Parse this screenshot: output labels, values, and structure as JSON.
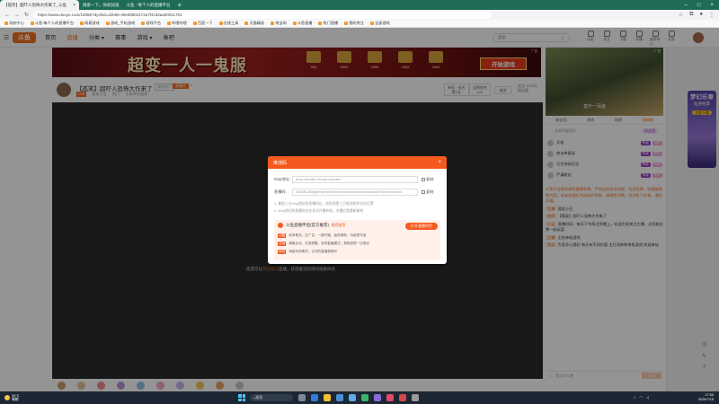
{
  "browser": {
    "tabs": [
      {
        "label": "【孤笑】超吓人恐怖大作来了_斗鱼",
        "active": true
      },
      {
        "label": "搜索一下，你就知道",
        "active": false
      },
      {
        "label": "斗鱼 - 每个人的直播平台",
        "active": false
      }
    ],
    "url": "https://www.douyu.com/10068?dyshid=d1b95-30e00804172a7f4cd2aa00011701",
    "bookmarks": [
      "导航中心",
      "斗鱼-每个人的直播平台",
      "网易游戏",
      "游戏_手机游戏",
      "游戏平台",
      "哔哩哔哩",
      "百度一下",
      "在线工具",
      "天猫精选",
      "淘宝网",
      "斗鱼直播",
      "热门直播",
      "我的关注",
      "全部游戏"
    ]
  },
  "site": {
    "logo": "斗鱼",
    "nav": [
      "首页",
      "直播",
      "分类",
      "赛事",
      "游戏",
      "鱼吧"
    ],
    "active_nav": "直播",
    "search_placeholder": "搜索",
    "header_icons": [
      "历史",
      "关注",
      "下载",
      "开播",
      "创作中心",
      "任务"
    ]
  },
  "banner": {
    "title": "超变一人一鬼服",
    "button": "开始游戏",
    "ad_label": "广告",
    "items": [
      "888",
      "6888",
      "5888",
      "2888",
      "1888"
    ]
  },
  "room": {
    "title": "【孤笑】超吓人恐怖大作来了",
    "tag1": "单机热门",
    "tag2": "直播中",
    "level": "LV8",
    "sub_items": [
      "孤笑小丑",
      "热门",
      "主机单机游戏"
    ],
    "rank1": [
      "单机 · 排名",
      "第1名"
    ],
    "rank2": [
      "总榜排名",
      "123"
    ],
    "follow_button": "关注",
    "follow_count": [
      "关注 1234万",
      "粉丝团"
    ]
  },
  "player": {
    "notice_prefix": "您还可以",
    "notice_link": "开启推流",
    "notice_suffix": "直播，获得推流权限的观看体验"
  },
  "modal": {
    "title": "推流码",
    "rtmp_label": "rtmp地址:",
    "rtmp_value": "rtmp://sendtc1.douyu.com/live",
    "key_label": "直播码:",
    "key_value": "10068rJ2MqtpBeq?txSecret=xxxxxxxxxxxxxxxxxxxx&txTime=xxxxxxxx",
    "copy_label": "复制",
    "tips": [
      "1. 复制上方rtmp地址和直播码后，粘贴到第三方推流软件对应位置",
      "2. rtmp地址和直播码仅在本次开播有效，关播后需重新复制"
    ],
    "promo_title": "斗鱼直播伴侣(官方推荐)",
    "promo_sub": "推荐使用",
    "promo_button": "打开直播伴侣",
    "promo_lines": [
      {
        "tag": "功能",
        "text": "纯净推流，无广告，一键开播，画质清晰，功能更丰富"
      },
      {
        "tag": "互动",
        "text": "弹幕互动，礼物提醒，多种直播模式，美颜滤镜一应俱全"
      },
      {
        "tag": "特效",
        "text": "海量特效素材，让你的直播更精彩"
      }
    ]
  },
  "sidebar": {
    "video_title": "直升一百级",
    "video_ad": "广告",
    "rank_tabs": [
      "粉丝团",
      "贵宾",
      "周榜",
      "贡献榜"
    ],
    "active_rank_tab": "贡献榜",
    "rank_sub": "本周贡献排行",
    "rank_sub_pill": "粉丝团",
    "rank_rows": [
      {
        "name": "天佑",
        "b1": "等级",
        "b2": "贵宾"
      },
      {
        "name": "夜未央星辰",
        "b1": "等级",
        "b2": "贵宾"
      },
      {
        "name": "天空海阔天空",
        "b1": "等级",
        "b2": "贵宾"
      },
      {
        "name": "严谨粉丝",
        "b1": "等级",
        "b2": "贵宾"
      }
    ],
    "chat_system": "斗鱼平台倡导绿色健康直播，严禁出现违法违规、低俗色情、吸烟酗酒等内容，若有违规行为请及时举报。请理性消费，切勿私下交易，谨防诈骗。",
    "chat_msgs": [
      {
        "user": "主播",
        "text": "孤笑小丑"
      },
      {
        "user": "房间",
        "text": "【孤笑】超吓人恐怖大作来了"
      },
      {
        "user": "公告",
        "text": "直播时间：每天下午两点到晚上，欢迎大家关注主播，点亮粉丝牌一起玩耍"
      },
      {
        "user": "主播",
        "text": "主机单机游戏"
      },
      {
        "user": "观众",
        "text": "大家开心就好 每天有不同内容 主打恐怖和单机游戏 欢迎来玩"
      }
    ],
    "chat_input_placeholder": "说点什么吧",
    "send_button": "发送",
    "rail_promo": {
      "title": "梦幻乐章",
      "sub": "仙侠经典",
      "button": "立即下载"
    }
  },
  "taskbar": {
    "weather": [
      "29°C",
      "晴朗"
    ],
    "search_placeholder": "搜索",
    "time": "17:00",
    "date": "2024/7/15"
  },
  "colors": {
    "accent": "#f4591d",
    "chrome": "#1f6b58",
    "taskbar": "#1c2733"
  }
}
